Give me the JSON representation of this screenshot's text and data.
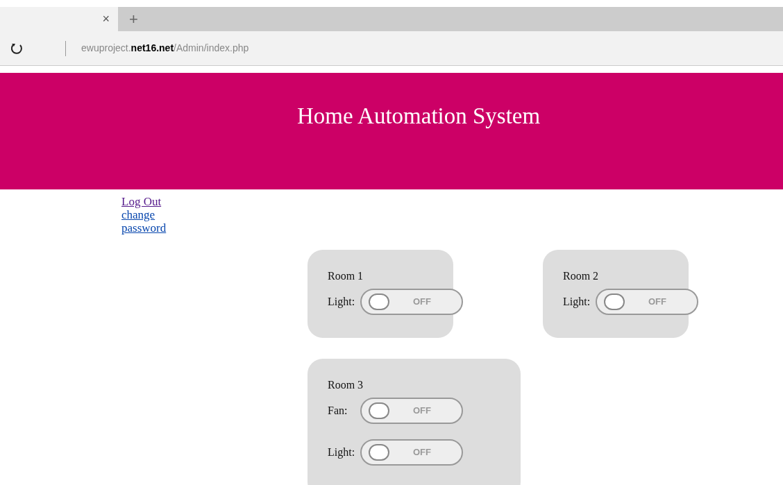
{
  "browser": {
    "close_tab": "×",
    "new_tab": "+",
    "url_host": "ewuproject.",
    "url_domain": "net16.net",
    "url_path": "/Admin/index.php"
  },
  "header": {
    "title": "Home Automation System"
  },
  "links": [
    "Log Out",
    "change password"
  ],
  "rooms": [
    {
      "name": "Room 1",
      "devices": [
        {
          "label": "Light:",
          "on": false,
          "state_text": "OFF"
        }
      ]
    },
    {
      "name": "Room 2",
      "devices": [
        {
          "label": "Light:",
          "on": false,
          "state_text": "OFF"
        }
      ]
    },
    {
      "name": "Room 3",
      "devices": [
        {
          "label": "Fan:",
          "on": false,
          "state_text": "OFF"
        },
        {
          "label": "Light:",
          "on": false,
          "state_text": "OFF"
        }
      ]
    }
  ]
}
